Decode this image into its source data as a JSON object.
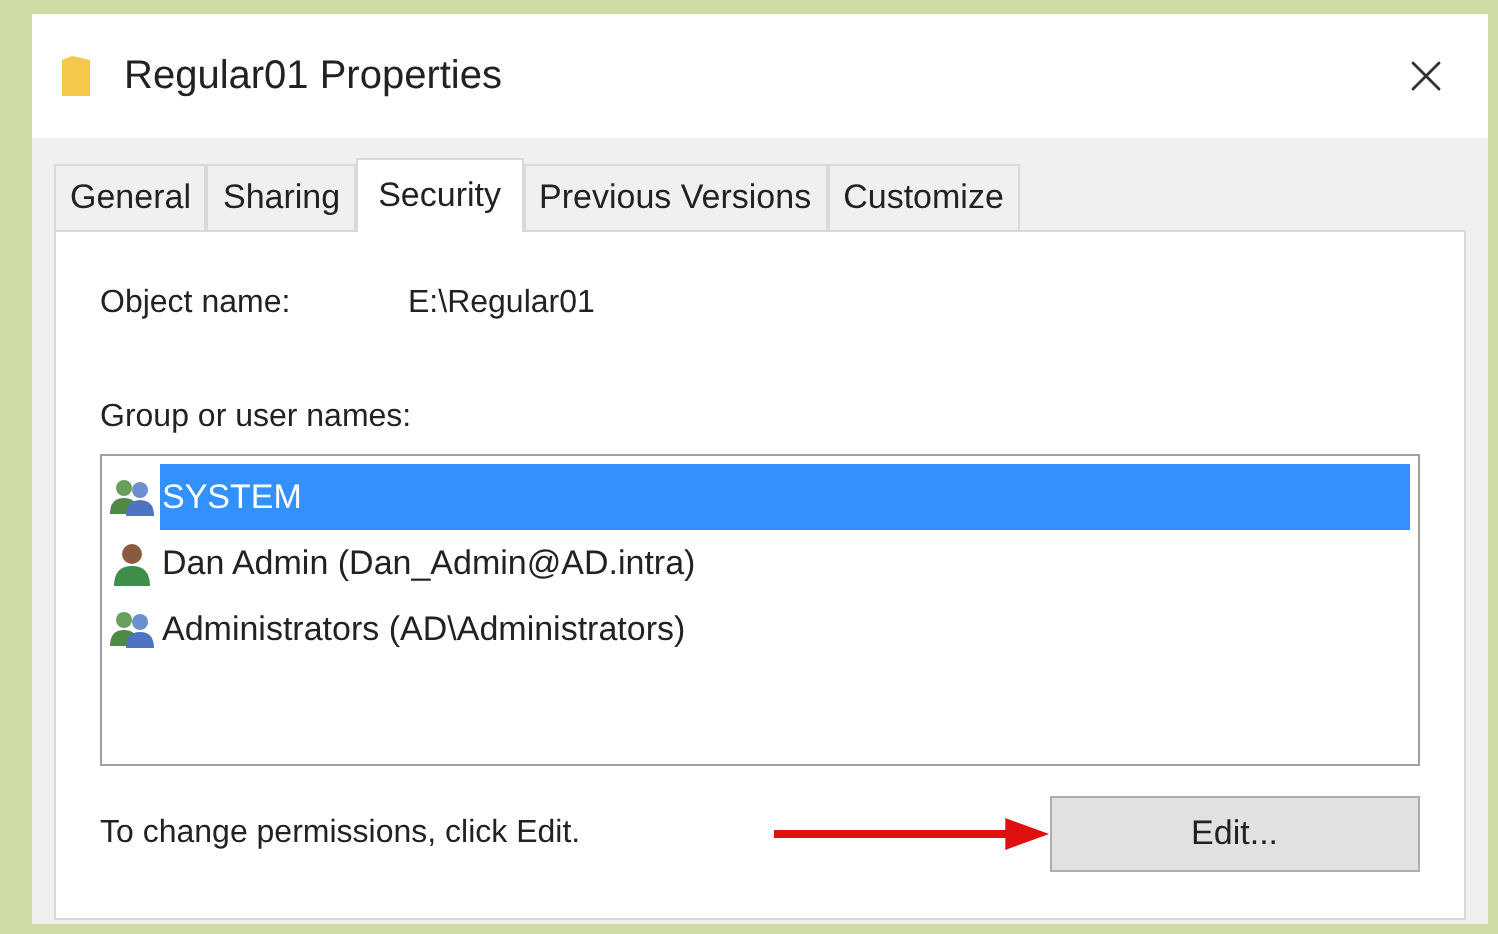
{
  "window": {
    "title": "Regular01 Properties"
  },
  "tabs": [
    {
      "label": "General",
      "selected": false
    },
    {
      "label": "Sharing",
      "selected": false
    },
    {
      "label": "Security",
      "selected": true
    },
    {
      "label": "Previous Versions",
      "selected": false
    },
    {
      "label": "Customize",
      "selected": false
    }
  ],
  "object_name": {
    "label": "Object name:",
    "value": "E:\\Regular01"
  },
  "group_list": {
    "label": "Group or user names:",
    "items": [
      {
        "kind": "group",
        "name": "SYSTEM",
        "selected": true
      },
      {
        "kind": "user",
        "name": "Dan Admin (Dan_Admin@AD.intra)",
        "selected": false
      },
      {
        "kind": "group",
        "name": "Administrators (AD\\Administrators)",
        "selected": false
      }
    ]
  },
  "hint": "To change permissions, click Edit.",
  "edit_button": "Edit..."
}
